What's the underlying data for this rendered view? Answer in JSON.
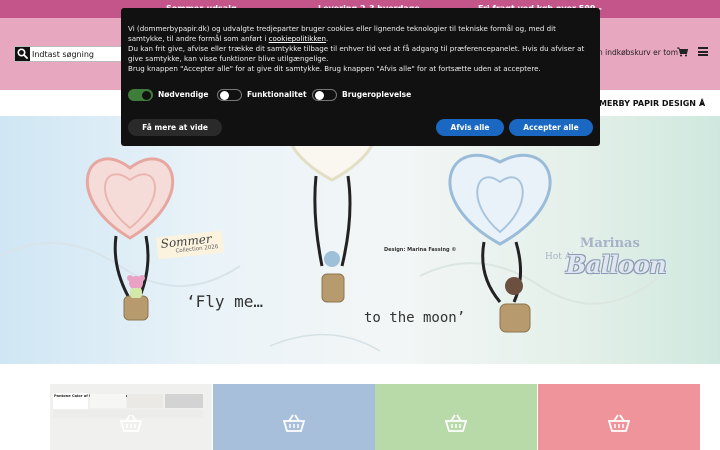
{
  "promo": {
    "item1": "Sommer-udsalg",
    "item2": "Levering 2-3 hverdage",
    "item3": "Fri fragt ved køb over 599,-"
  },
  "header": {
    "search_placeholder": "Indtast søgning",
    "cart_text": "n indkøbskurv er tom"
  },
  "nav": {
    "items": [
      {
        "label": "MMERBY PAPIR DESIGN",
        "chevron": "chevron-down-icon"
      },
      {
        "label": "Å"
      }
    ]
  },
  "hero": {
    "sommer_title": "Sommer",
    "sommer_subtitle": "Collection 2026",
    "design_credit": "Design: Marina Fassing ©",
    "fly_text": "‘Fly me…",
    "moon_text": "to the moon’",
    "brand_marinas": "Marinas",
    "brand_hotair": "Hot Air",
    "brand_balloon": "Balloon"
  },
  "tiles": [
    {
      "name": "pantone-tile",
      "color": "#f0f0ef",
      "caption": "Pantone Color of the Year 2026 Cloud Dancer"
    },
    {
      "name": "blue-tile",
      "color": "#a7bfda"
    },
    {
      "name": "green-tile",
      "color": "#b8d9a8"
    },
    {
      "name": "pink-tile",
      "color": "#f0949c"
    }
  ],
  "cookie": {
    "line1": "Vi (dommerbypapir.dk) og udvalgte tredjeparter bruger cookies eller lignende teknologier til tekniske formål og, med dit samtykke, til andre formål som anført i",
    "link": "cookiepolitikken",
    "line2": "Du kan frit give, afvise eller trække dit samtykke tilbage til enhver tid ved at få adgang til præferencepanelet. Hvis du afviser at give samtykke, kan visse funktioner blive utilgængelige.",
    "line3": "Brug knappen \"Accepter alle\" for at give dit samtykke. Brug knappen \"Afvis alle\" for at fortsætte uden at acceptere.",
    "toggles": [
      {
        "label": "Nødvendige",
        "state": "on"
      },
      {
        "label": "Funktionalitet",
        "state": "off"
      },
      {
        "label": "Brugeroplevelse",
        "state": "off"
      }
    ],
    "more_button": "Få mere at vide",
    "reject_button": "Afvis alle",
    "accept_button": "Accepter alle"
  },
  "colors": {
    "promo_bar": "#c4558b",
    "header_bg": "#e7a7bf",
    "button_blue": "#1a68c2",
    "toggle_on": "#3f7d3a"
  },
  "icons": {
    "search": "search-icon",
    "cart": "cart-icon",
    "menu": "hamburger-menu-icon",
    "basket": "basket-icon"
  }
}
